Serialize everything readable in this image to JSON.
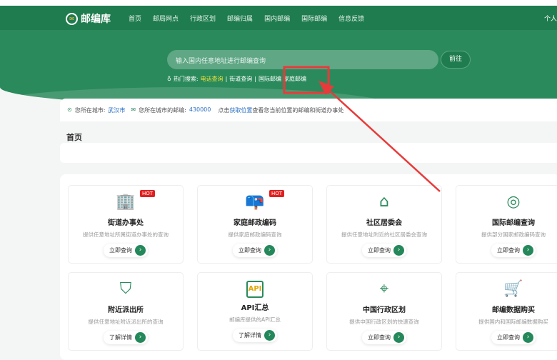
{
  "header": {
    "logo": "邮编库",
    "menu": [
      "首页",
      "邮局网点",
      "行政区划",
      "邮编归属",
      "国内邮编",
      "国际邮编",
      "信息反馈"
    ],
    "user": "个人"
  },
  "search": {
    "placeholder": "输入国内任意地址进行邮编查询",
    "button": "前往"
  },
  "hot": {
    "label": "热门搜索:",
    "items": [
      "电话查询",
      "街道查询",
      "国际邮编",
      "家庭邮编"
    ]
  },
  "info": {
    "city_label": "您所在城市:",
    "city": "武汉市",
    "zip_label": "您所在城市的邮编:",
    "zip": "430000",
    "pre": "点击",
    "link": "获取位置",
    "post": "查看您当前位置的邮编和街道办事处"
  },
  "page_title": "首页",
  "cards": [
    {
      "title": "街道办事处",
      "desc": "提供任意地址所属街道办事处的查询",
      "btn": "立即查询",
      "hot": "HOT",
      "icon": "🏢"
    },
    {
      "title": "家庭邮政编码",
      "desc": "提供家庭邮政编码查询",
      "btn": "立即查询",
      "hot": "HOT",
      "icon": "📪"
    },
    {
      "title": "社区居委会",
      "desc": "提供任意地址附近的社区居委会查询",
      "btn": "立即查询",
      "icon": "⌂"
    },
    {
      "title": "国际邮编查询",
      "desc": "提供部分国家邮政编码查询",
      "btn": "立即查询",
      "icon": "◎"
    },
    {
      "title": "附近派出所",
      "desc": "提供任意地址附近派出所的查询",
      "btn": "了解详情",
      "icon": "⛉"
    },
    {
      "title": "API汇总",
      "desc": "邮编库提供的API汇总",
      "btn": "了解详情",
      "icon": "API"
    },
    {
      "title": "中国行政区划",
      "desc": "提供中国行政区划的快速查询",
      "btn": "立即查询",
      "icon": "⌖"
    },
    {
      "title": "邮编数据购买",
      "desc": "提供国内和国际邮编数据购买",
      "btn": "立即查询",
      "icon": "🛒"
    }
  ]
}
